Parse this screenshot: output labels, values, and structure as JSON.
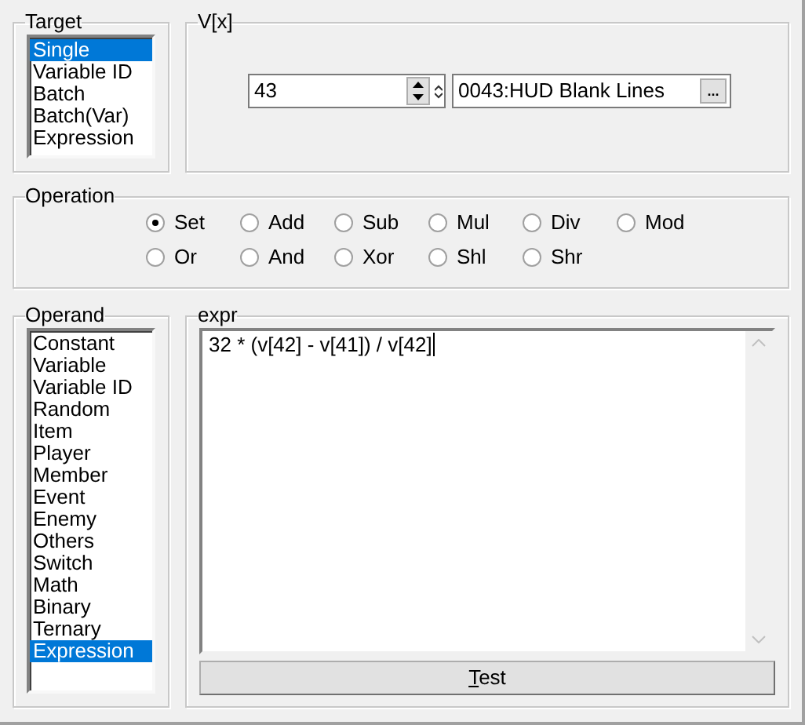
{
  "target": {
    "title": "Target",
    "items": [
      {
        "label": "Single",
        "selected": true
      },
      {
        "label": "Variable ID",
        "selected": false
      },
      {
        "label": "Batch",
        "selected": false
      },
      {
        "label": "Batch(Var)",
        "selected": false
      },
      {
        "label": "Expression",
        "selected": false
      }
    ]
  },
  "variable": {
    "title": "V[x]",
    "id_value": "43",
    "name_value": "0043:HUD Blank Lines",
    "browse_label": "..."
  },
  "operation": {
    "title": "Operation",
    "options": [
      {
        "label": "Set",
        "selected": true
      },
      {
        "label": "Add",
        "selected": false
      },
      {
        "label": "Sub",
        "selected": false
      },
      {
        "label": "Mul",
        "selected": false
      },
      {
        "label": "Div",
        "selected": false
      },
      {
        "label": "Mod",
        "selected": false
      },
      {
        "label": "Or",
        "selected": false
      },
      {
        "label": "And",
        "selected": false
      },
      {
        "label": "Xor",
        "selected": false
      },
      {
        "label": "Shl",
        "selected": false
      },
      {
        "label": "Shr",
        "selected": false
      }
    ]
  },
  "operand": {
    "title": "Operand",
    "items": [
      {
        "label": "Constant",
        "selected": false
      },
      {
        "label": "Variable",
        "selected": false
      },
      {
        "label": "Variable ID",
        "selected": false
      },
      {
        "label": "Random",
        "selected": false
      },
      {
        "label": "Item",
        "selected": false
      },
      {
        "label": "Player",
        "selected": false
      },
      {
        "label": "Member",
        "selected": false
      },
      {
        "label": "Event",
        "selected": false
      },
      {
        "label": "Enemy",
        "selected": false
      },
      {
        "label": "Others",
        "selected": false
      },
      {
        "label": "Switch",
        "selected": false
      },
      {
        "label": "Math",
        "selected": false
      },
      {
        "label": "Binary",
        "selected": false
      },
      {
        "label": "Ternary",
        "selected": false
      },
      {
        "label": "Expression",
        "selected": true
      }
    ]
  },
  "expr": {
    "title": "expr",
    "value": "32 * (v[42] - v[41]) / v[42]",
    "test_button": "Test"
  }
}
